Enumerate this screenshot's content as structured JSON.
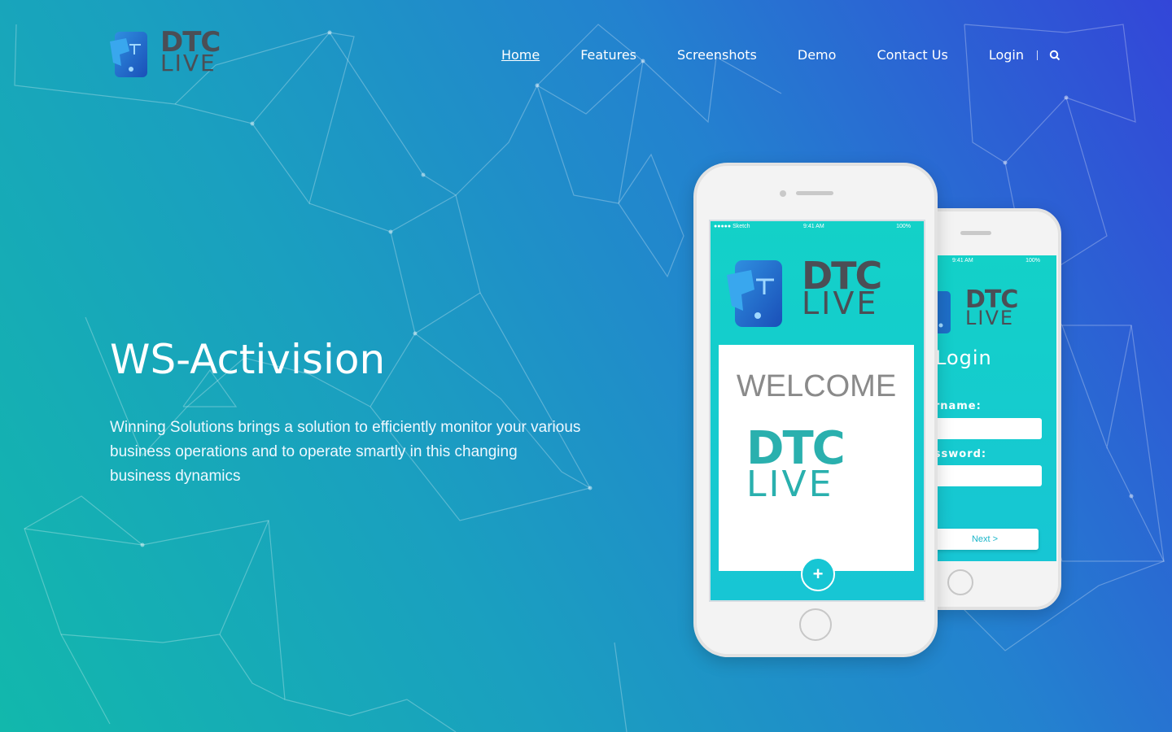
{
  "brand": {
    "line1": "DTC",
    "line2": "LIVE"
  },
  "nav": {
    "items": [
      {
        "label": "Home",
        "active": true
      },
      {
        "label": "Features"
      },
      {
        "label": "Screenshots"
      },
      {
        "label": "Demo"
      },
      {
        "label": "Contact Us"
      },
      {
        "label": "Login"
      }
    ],
    "search_icon": "search-icon"
  },
  "hero": {
    "title": "WS-Activision",
    "description": "Winning Solutions brings a solution to efficiently monitor your various business operations and to operate smartly in this changing business dynamics"
  },
  "phone_front": {
    "status_carrier": "●●●●● Sketch",
    "status_time": "9:41 AM",
    "status_battery": "100%",
    "logo_line1": "DTC",
    "logo_line2": "LIVE",
    "welcome": "WELCOME",
    "card_line1": "DTC",
    "card_line2": "LIVE",
    "plus": "+"
  },
  "phone_back": {
    "status_time": "9:41 AM",
    "status_battery": "100%",
    "logo_line1": "DTC",
    "logo_line2": "LIVE",
    "title": "Login",
    "username_label": "ername:",
    "password_label": "assword:",
    "next_label": "Next >"
  },
  "colors": {
    "gradient_start": "#12b8ac",
    "gradient_end": "#3346d8",
    "logo_text": "#4b4e55",
    "card_logo": "#2ab0ae",
    "screen_teal": "#13d1c8"
  }
}
